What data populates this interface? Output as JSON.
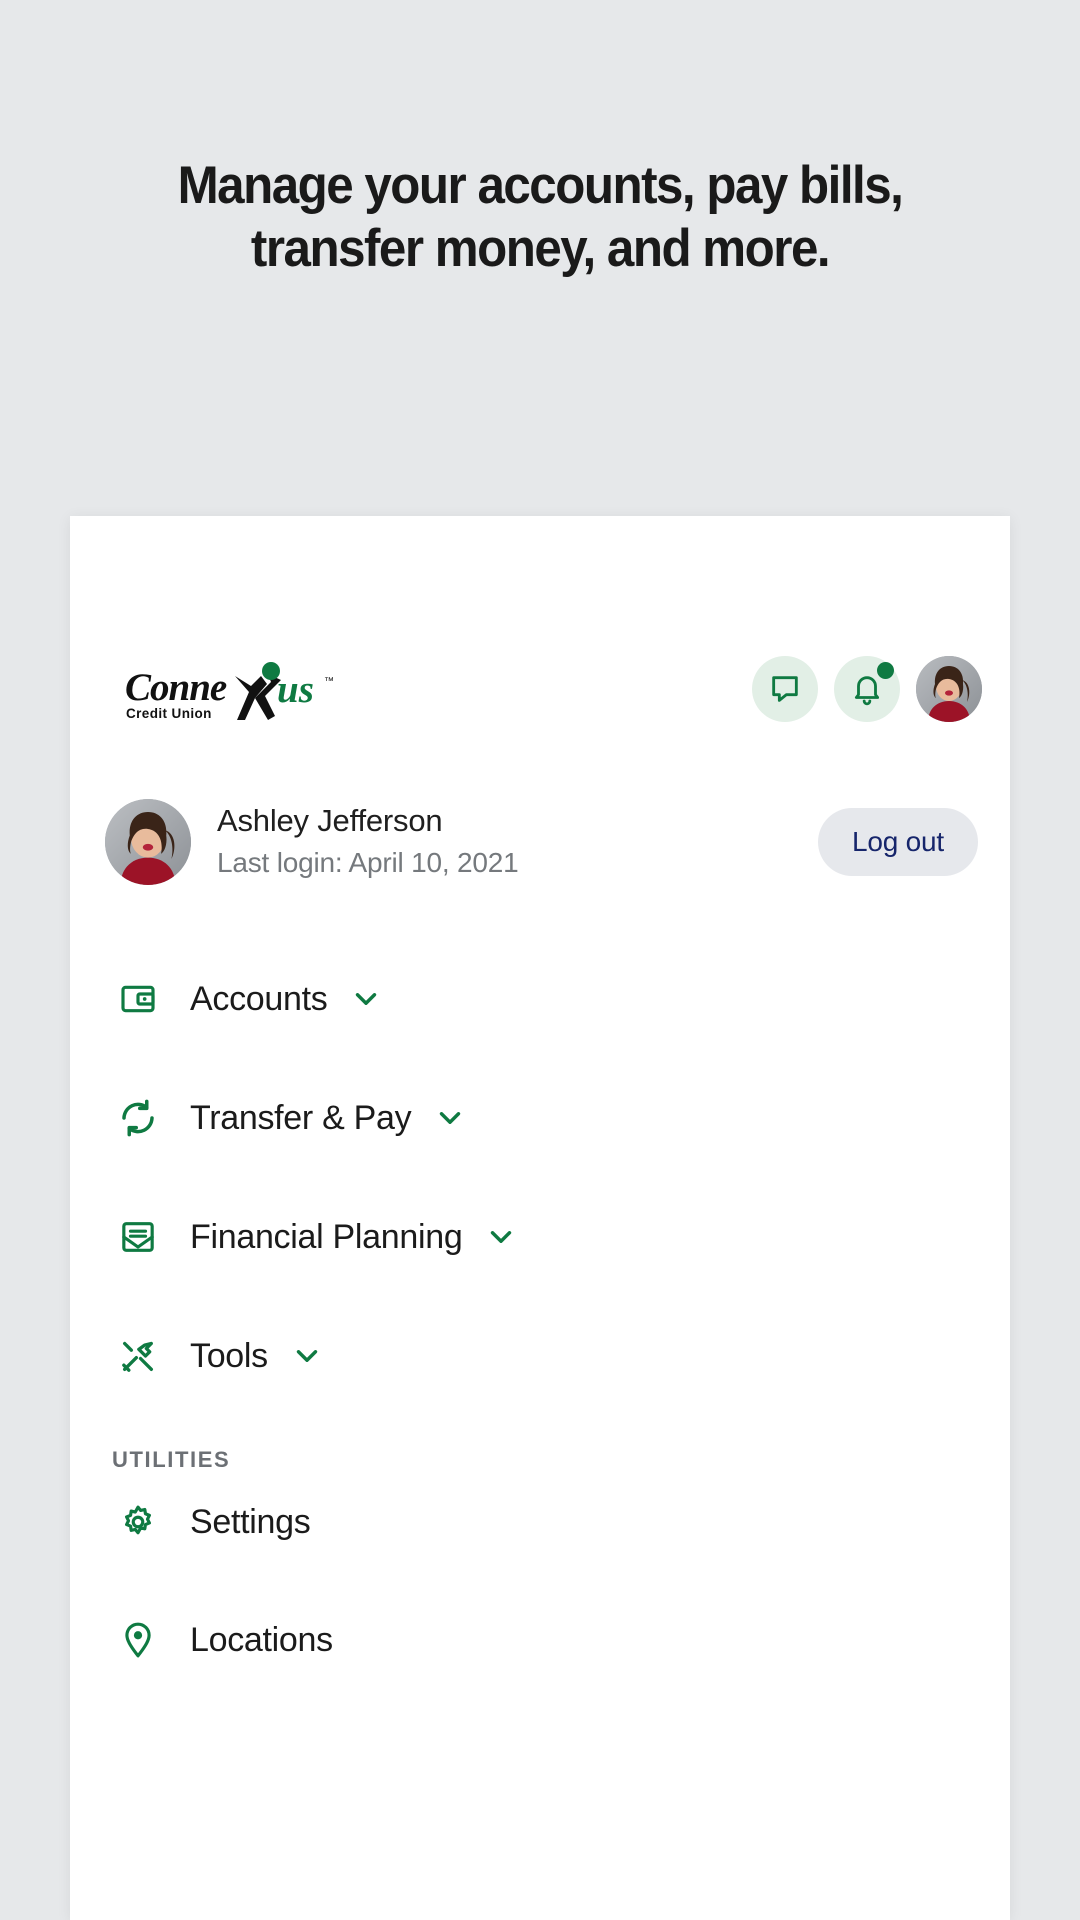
{
  "headline": {
    "line1": "Manage your accounts, pay bills,",
    "line2": "transfer money, and more."
  },
  "app": {
    "logo": {
      "wordmark_dark": "Conne",
      "wordmark_green": "us",
      "tagline": "Credit Union"
    },
    "header_actions": [
      {
        "name": "messages",
        "icon": "chat-bubble-icon"
      },
      {
        "name": "notifications",
        "icon": "bell-icon",
        "has_badge": true
      },
      {
        "name": "profile",
        "icon": "avatar"
      }
    ],
    "user": {
      "name": "Ashley Jefferson",
      "last_login": "Last login: April 10, 2021",
      "logout_label": "Log out"
    },
    "nav": [
      {
        "label": "Accounts",
        "icon": "wallet-icon",
        "expandable": true
      },
      {
        "label": "Transfer & Pay",
        "icon": "transfer-arrows-icon",
        "expandable": true
      },
      {
        "label": "Financial Planning",
        "icon": "envelope-document-icon",
        "expandable": true
      },
      {
        "label": "Tools",
        "icon": "hammer-screwdriver-icon",
        "expandable": true
      }
    ],
    "utilities_header": "UTILITIES",
    "utilities": [
      {
        "label": "Settings",
        "icon": "gear-icon",
        "expandable": false
      },
      {
        "label": "Locations",
        "icon": "map-pin-icon",
        "expandable": false
      }
    ]
  },
  "colors": {
    "page_background": "#e6e8ea",
    "card_background": "#ffffff",
    "brand_green": "#0f7a42",
    "icon_circle": "#e2efe6",
    "logout_text": "#16256b",
    "logout_background": "#e6e8ec",
    "muted_text": "#75797d"
  }
}
